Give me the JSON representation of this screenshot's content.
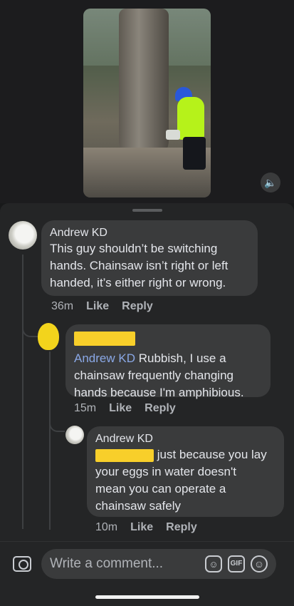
{
  "video": {
    "volume_icon": "speaker-icon"
  },
  "comments": [
    {
      "author": "Andrew KD",
      "lines": [
        "This guy shouldn’t be switching",
        "hands. Chainsaw isn’t right or left",
        "handed, it’s either right or wrong."
      ],
      "time": "36m",
      "like": "Like",
      "reply": "Reply"
    },
    {
      "mention": "Andrew KD",
      "line1_rest": " Rubbish, I use a",
      "lines": [
        "chainsaw frequently changing",
        "hands because I'm amphibious."
      ],
      "time": "15m",
      "like": "Like",
      "reply": "Reply"
    },
    {
      "author": "Andrew KD",
      "line1_rest": " just because you lay",
      "lines": [
        "your eggs in water doesn't",
        "mean you can operate a",
        "chainsaw safely"
      ],
      "time": "10m",
      "like": "Like",
      "reply": "Reply"
    }
  ],
  "composer": {
    "placeholder": "Write a comment...",
    "camera_icon": "camera-icon",
    "sticker_icon": "sticker-icon",
    "gif_label": "GIF",
    "emoji_icon": "emoji-icon"
  }
}
